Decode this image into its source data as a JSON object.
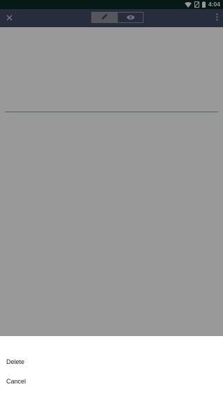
{
  "status_bar": {
    "time": "4:04",
    "icons": [
      "wifi-icon",
      "no-sim-icon",
      "battery-icon"
    ],
    "background": "#0b2a22"
  },
  "app_bar": {
    "background": "#414b67",
    "close_icon": "close-icon",
    "mode_toggle": {
      "options": [
        {
          "id": "edit",
          "icon": "pencil-icon",
          "selected": true
        },
        {
          "id": "preview",
          "icon": "eye-icon",
          "selected": false
        }
      ]
    },
    "menu_icon": "more-vert-icon"
  },
  "bottom_sheet": {
    "items": [
      {
        "label": "Delete"
      },
      {
        "label": "Cancel"
      }
    ]
  },
  "colors": {
    "scrim": "rgba(0,0,0,0.40)",
    "divider": "#7fa7a4",
    "toggle_selected": "#8e9298"
  }
}
